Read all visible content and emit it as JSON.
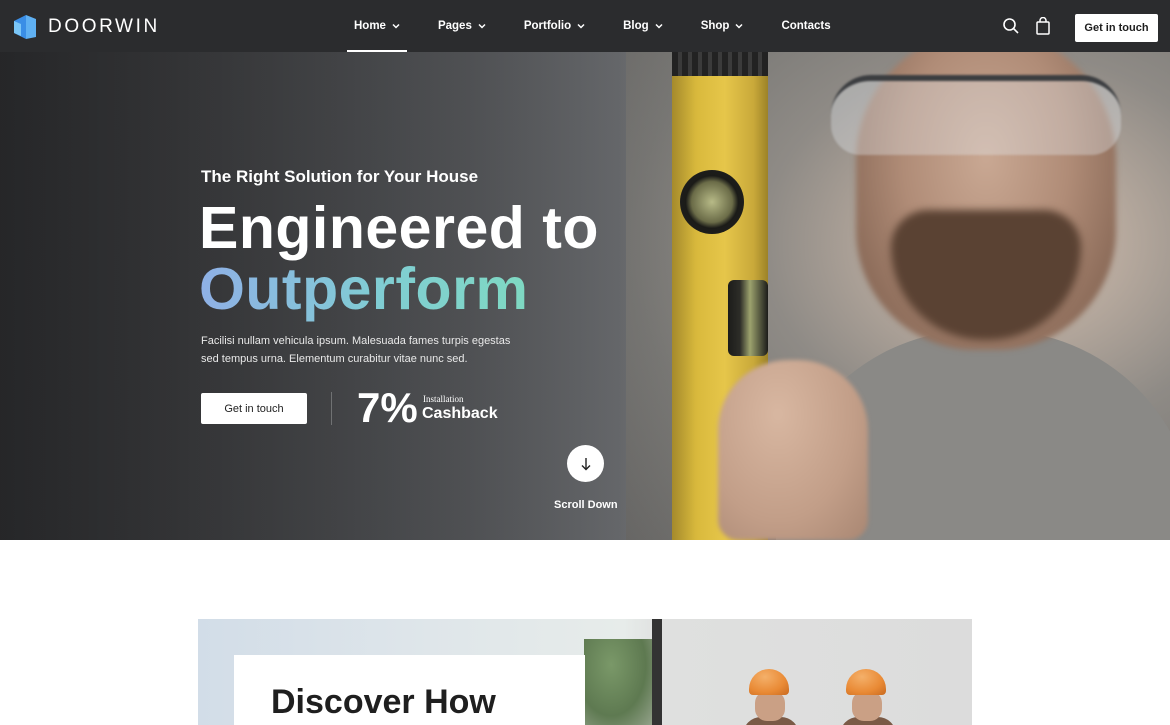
{
  "brand": {
    "name": "DOORWIN"
  },
  "nav": {
    "items": [
      {
        "label": "Home",
        "has_dropdown": true,
        "active": true
      },
      {
        "label": "Pages",
        "has_dropdown": true
      },
      {
        "label": "Portfolio",
        "has_dropdown": true
      },
      {
        "label": "Blog",
        "has_dropdown": true
      },
      {
        "label": "Shop",
        "has_dropdown": true
      },
      {
        "label": "Contacts",
        "has_dropdown": false
      }
    ],
    "icons": [
      "search-icon",
      "shopping-bag-icon"
    ],
    "cta_label": "Get in touch"
  },
  "hero": {
    "tagline": "The Right Solution for Your House",
    "headline_line1": "Engineered to",
    "headline_line2": "Outperform",
    "description": "Facilisi nullam vehicula ipsum. Malesuada fames turpis egestas sed tempus urna. Elementum curabitur vitae nunc sed.",
    "cta_label": "Get in touch",
    "cashback_percent": "7%",
    "cashback_caption_small": "Installation",
    "cashback_caption_big": "Cashback",
    "scroll_label": "Scroll Down"
  },
  "section2": {
    "title": "Discover How"
  },
  "colors": {
    "navbar_bg": "#2b2c2e",
    "headline_gradient_start": "#8fb0e6",
    "headline_gradient_end": "#7fd9c2",
    "logo_blue": "#3a8ee6"
  }
}
